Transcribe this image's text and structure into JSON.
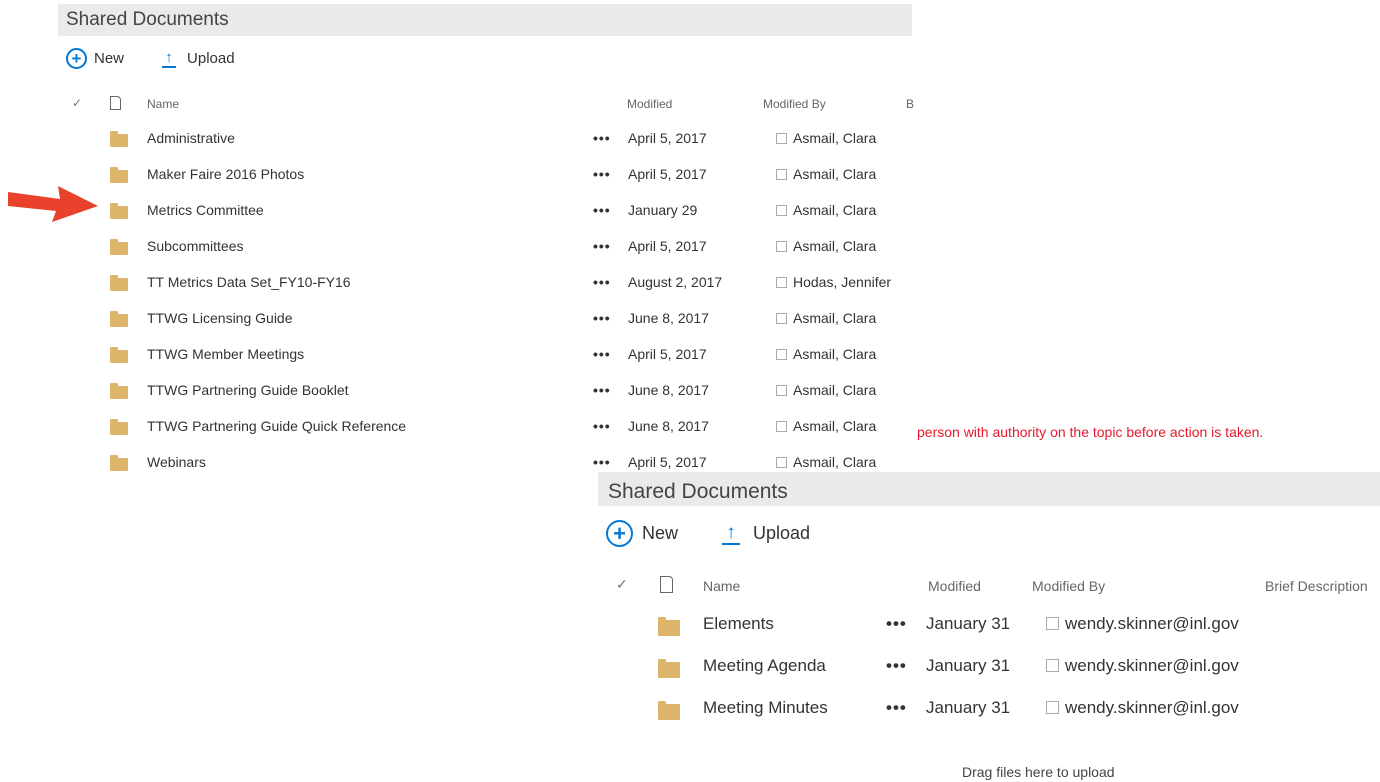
{
  "panel_top": {
    "title": "Shared Documents",
    "toolbar": {
      "new_label": "New",
      "upload_label": "Upload"
    },
    "columns": {
      "check": "✓",
      "name": "Name",
      "modified": "Modified",
      "modified_by": "Modified By",
      "cut_column": "B"
    },
    "rows": [
      {
        "name": "Administrative",
        "modified": "April 5, 2017",
        "modified_by": "Asmail, Clara"
      },
      {
        "name": "Maker Faire 2016 Photos",
        "modified": "April 5, 2017",
        "modified_by": "Asmail, Clara"
      },
      {
        "name": "Metrics Committee",
        "modified": "January 29",
        "modified_by": "Asmail, Clara"
      },
      {
        "name": "Subcommittees",
        "modified": "April 5, 2017",
        "modified_by": "Asmail, Clara"
      },
      {
        "name": "TT Metrics Data Set_FY10-FY16",
        "modified": "August 2, 2017",
        "modified_by": "Hodas, Jennifer"
      },
      {
        "name": "TTWG Licensing Guide",
        "modified": "June 8, 2017",
        "modified_by": "Asmail, Clara"
      },
      {
        "name": "TTWG Member Meetings",
        "modified": "April 5, 2017",
        "modified_by": "Asmail, Clara"
      },
      {
        "name": "TTWG Partnering Guide Booklet",
        "modified": "June 8, 2017",
        "modified_by": "Asmail, Clara"
      },
      {
        "name": "TTWG Partnering Guide Quick Reference",
        "modified": "June 8, 2017",
        "modified_by": "Asmail, Clara"
      },
      {
        "name": "Webinars",
        "modified": "April 5, 2017",
        "modified_by": "Asmail, Clara"
      }
    ]
  },
  "warning_text": "person with authority on the topic before action is taken.",
  "panel_bottom": {
    "title": "Shared Documents",
    "toolbar": {
      "new_label": "New",
      "upload_label": "Upload"
    },
    "columns": {
      "check": "✓",
      "name": "Name",
      "modified": "Modified",
      "modified_by": "Modified By",
      "brief_description": "Brief Description"
    },
    "rows": [
      {
        "name": "Elements",
        "modified": "January 31",
        "modified_by": "wendy.skinner@inl.gov"
      },
      {
        "name": "Meeting Agenda",
        "modified": "January 31",
        "modified_by": "wendy.skinner@inl.gov"
      },
      {
        "name": "Meeting Minutes",
        "modified": "January 31",
        "modified_by": "wendy.skinner@inl.gov"
      }
    ],
    "drag_hint": "Drag files here to upload"
  },
  "ellipsis": "•••",
  "colors": {
    "accent": "#0078d4",
    "folder": "#dcb56b",
    "annotation_arrow": "#e8412c",
    "warning": "#e8192c"
  },
  "icons": [
    "plus-circle-icon",
    "upload-arrow-icon",
    "checkmark-icon",
    "document-icon",
    "folder-icon",
    "ellipsis-icon",
    "person-icon",
    "red-arrow-icon"
  ]
}
